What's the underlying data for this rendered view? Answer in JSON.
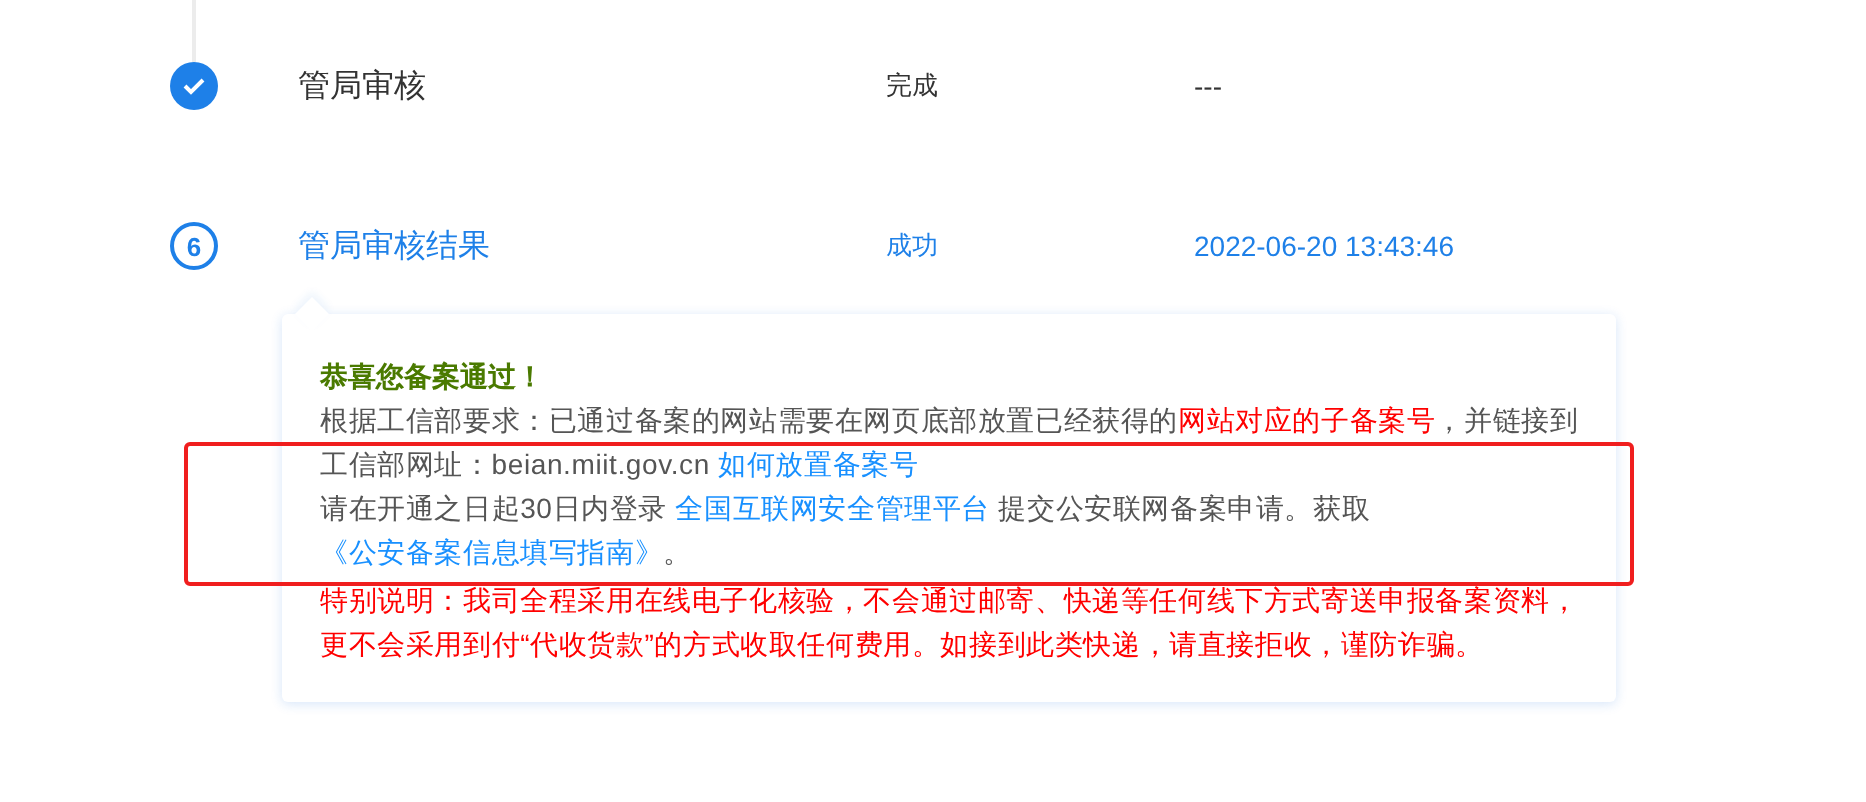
{
  "steps": [
    {
      "kind": "done",
      "title": "管局审核",
      "status": "完成",
      "time": "---"
    },
    {
      "kind": "current",
      "number": "6",
      "title": "管局审核结果",
      "status": "成功",
      "time": "2022-06-20 13:43:46"
    }
  ],
  "notice": {
    "heading": "恭喜您备案通过！",
    "paragraphs": [
      {
        "kind": "info",
        "segments": [
          {
            "kind": "plain",
            "text": "根据工信部要求：已通过备案的网站需要在网页底部放置已经获得的"
          },
          {
            "kind": "red",
            "text": "网站对应的子备案号"
          },
          {
            "kind": "plain",
            "text": "，并链接到工信部网址：beian.miit.gov.cn "
          },
          {
            "kind": "link",
            "text": "如何放置备案号"
          }
        ]
      },
      {
        "kind": "info",
        "segments": [
          {
            "kind": "plain",
            "text": "请在开通之日起30日内登录 "
          },
          {
            "kind": "link",
            "text": "全国互联网安全管理平台"
          },
          {
            "kind": "plain",
            "text": " 提交公安联网备案申请。获取"
          },
          {
            "kind": "link",
            "text": "《公安备案信息填写指南》"
          },
          {
            "kind": "plain",
            "text": "。"
          }
        ]
      },
      {
        "kind": "warning",
        "segments": [
          {
            "kind": "plain",
            "text": "特别说明：我司全程采用在线电子化核验，不会通过邮寄、快递等任何线下方式寄送申报备案资料，更不会采用到付“代收货款”的方式收取任何费用。如接到此类快递，请直接拒收，谨防诈骗。"
          }
        ]
      }
    ]
  },
  "highlight": {
    "kind": "rectangle"
  }
}
